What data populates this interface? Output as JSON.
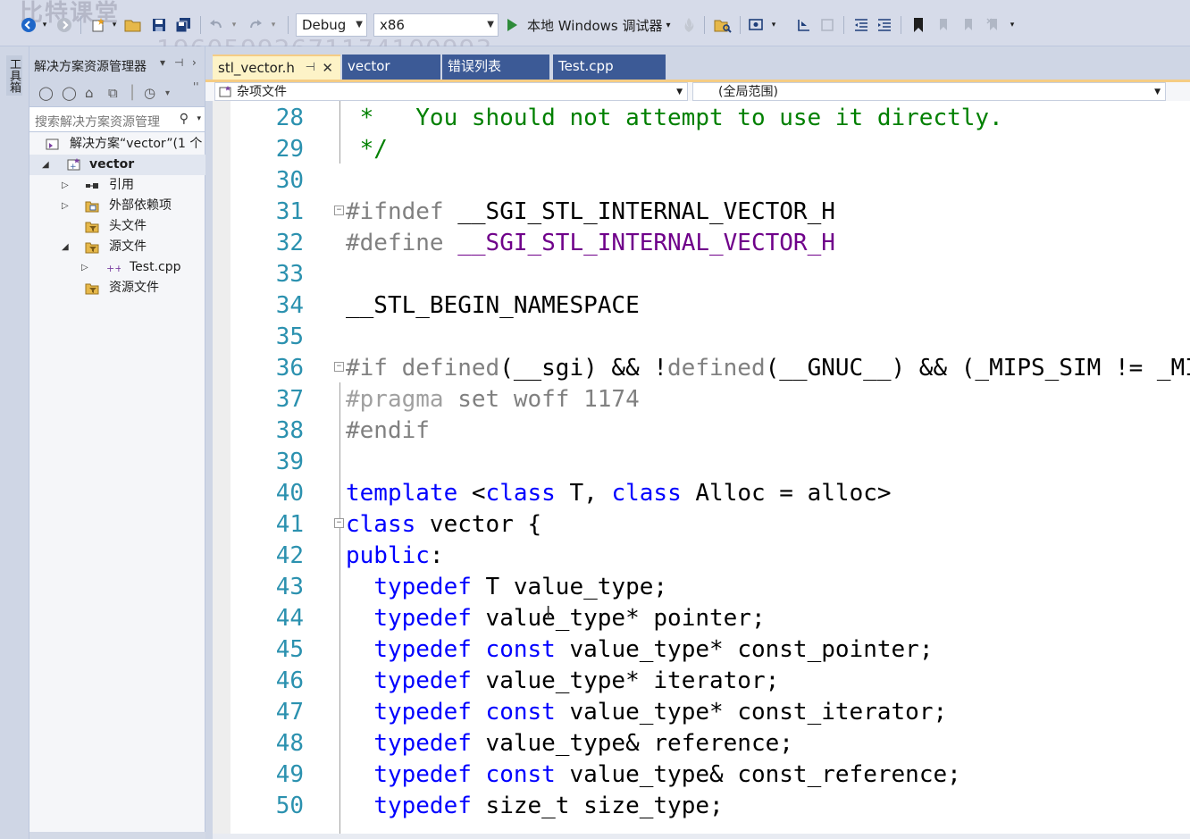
{
  "watermark": {
    "brand": "比特课堂",
    "id": "19605992671174100993"
  },
  "toolbar": {
    "config": "Debug",
    "platform": "x86",
    "run_label": "本地 Windows 调试器",
    "run_arrow": "▾"
  },
  "toolstrip": {
    "label": "工具箱"
  },
  "explorer": {
    "title": "解决方案资源管理器",
    "search_placeholder": "搜索解决方案资源管理",
    "tree": [
      {
        "label": "解决方案“vector”(1 个",
        "icon": "solution-icon",
        "expander": ""
      },
      {
        "label": "vector",
        "icon": "project-icon",
        "expander": "◢"
      },
      {
        "label": "引用",
        "icon": "references-icon",
        "expander": "▷"
      },
      {
        "label": "外部依赖项",
        "icon": "external-deps-icon",
        "expander": "▷"
      },
      {
        "label": "头文件",
        "icon": "filter-folder-icon",
        "expander": ""
      },
      {
        "label": "源文件",
        "icon": "filter-folder-icon",
        "expander": "◢"
      },
      {
        "label": "Test.cpp",
        "icon": "cpp-file-icon",
        "expander": "▷"
      },
      {
        "label": "资源文件",
        "icon": "filter-folder-icon",
        "expander": ""
      }
    ]
  },
  "tabs": [
    {
      "label": "stl_vector.h",
      "active": true
    },
    {
      "label": "vector",
      "active": false
    },
    {
      "label": "错误列表",
      "active": false
    },
    {
      "label": "Test.cpp",
      "active": false
    }
  ],
  "navbar": {
    "project": "杂项文件",
    "scope": "(全局范围)"
  },
  "code": {
    "line_numbers": [
      "28",
      "29",
      "30",
      "31",
      "32",
      "33",
      "34",
      "35",
      "36",
      "37",
      "38",
      "39",
      "40",
      "41",
      "42",
      "43",
      "44",
      "45",
      "46",
      "47",
      "48",
      "49",
      "50"
    ]
  },
  "colors": {
    "keyword": "#0000ff",
    "preprocessor": "#808080",
    "macro": "#6f008a",
    "comment": "#008000",
    "line_number": "#2b91af",
    "active_tab": "#fdf3c7",
    "tab_bg": "#3c5a96"
  }
}
